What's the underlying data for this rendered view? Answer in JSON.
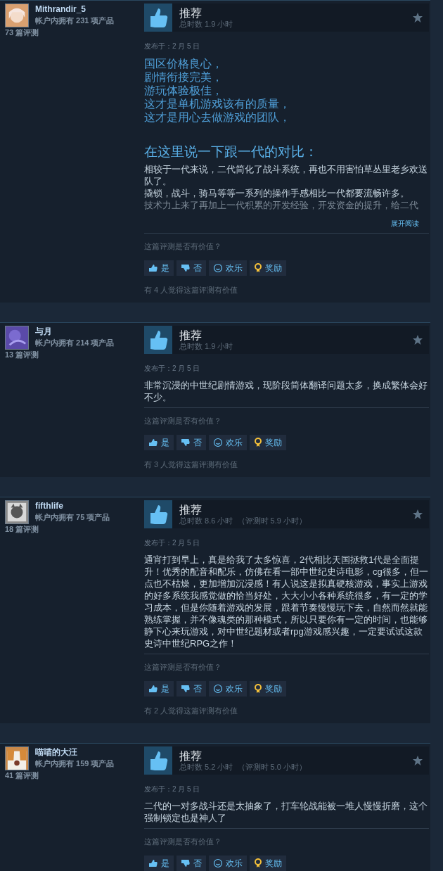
{
  "reviews": [
    {
      "user": {
        "name": "Mithrandir_5",
        "products": "帐户内拥有 231 项产品",
        "review_count": "73 篇评测"
      },
      "verdict": "推荐",
      "hours": "总时数 1.9 小时",
      "date": "发布于：2 月 5 日",
      "body": [
        {
          "kind": "highlight",
          "text": "国区价格良心，"
        },
        {
          "kind": "highlight",
          "text": "剧情衔接完美，"
        },
        {
          "kind": "highlight",
          "text": "游玩体验极佳，"
        },
        {
          "kind": "highlight",
          "text": "这才是单机游戏该有的质量，"
        },
        {
          "kind": "highlight",
          "text": "这才是用心去做游戏的团队，"
        },
        {
          "kind": "heading",
          "text": "在这里说一下跟一代的对比："
        },
        {
          "kind": "plain",
          "text": "相较于一代来说，二代简化了战斗系统，再也不用害怕草丛里老乡欢送队了。"
        },
        {
          "kind": "plain",
          "text": "撬锁，战斗，骑马等等一系列的操作手感相比一代都要流畅许多。"
        },
        {
          "kind": "faded",
          "text": "技术力上来了再加上一代积累的开发经验，开发资金的提升，给二代"
        }
      ],
      "expand": "展开阅读",
      "question": "这篇评测是否有价值？",
      "buttons": [
        {
          "kind": "yes",
          "label": "是"
        },
        {
          "kind": "no",
          "label": "否"
        },
        {
          "kind": "funny",
          "label": "欢乐"
        },
        {
          "kind": "award",
          "label": "奖励"
        }
      ],
      "helpful": "有 4 人觉得这篇评测有价值"
    },
    {
      "user": {
        "name": "与月",
        "products": "帐户内拥有 214 项产品",
        "review_count": "13 篇评测"
      },
      "verdict": "推荐",
      "hours": "总时数 1.9 小时",
      "date": "发布于：2 月 5 日",
      "body": [
        {
          "kind": "plain",
          "text": "非常沉浸的中世纪剧情游戏，现阶段简体翻译问题太多，换成繁体会好不少。"
        }
      ],
      "question": "这篇评测是否有价值？",
      "buttons": [
        {
          "kind": "yes",
          "label": "是"
        },
        {
          "kind": "no",
          "label": "否"
        },
        {
          "kind": "funny",
          "label": "欢乐"
        },
        {
          "kind": "award",
          "label": "奖励"
        }
      ],
      "helpful": "有 3 人觉得这篇评测有价值"
    },
    {
      "user": {
        "name": "fifthlife",
        "products": "帐户内拥有 75 项产品",
        "review_count": "18 篇评测"
      },
      "verdict": "推荐",
      "hours": "总时数 8.6 小时  （评测时 5.9 小时）",
      "date": "发布于：2 月 5 日",
      "body": [
        {
          "kind": "plain",
          "text": "通宵打到早上，真是给我了太多惊喜，2代相比天国拯救1代是全面提升！优秀的配音和配乐，仿佛在看一部中世纪史诗电影，cg很多，但一点也不枯燥，更加增加沉浸感！有人说这是拟真硬核游戏，事实上游戏的好多系统我感觉做的恰当好处，大大小小各种系统很多，有一定的学习成本，但是你随着游戏的发展，跟着节奏慢慢玩下去，自然而然就能熟练掌握，并不像魂类的那种模式，所以只要你有一定的时间，也能够静下心来玩游戏，对中世纪题材或者rpg游戏感兴趣，一定要试试这款史诗中世纪RPG之作！"
        }
      ],
      "question": "这篇评测是否有价值？",
      "buttons": [
        {
          "kind": "yes",
          "label": "是"
        },
        {
          "kind": "no",
          "label": "否"
        },
        {
          "kind": "funny",
          "label": "欢乐"
        },
        {
          "kind": "award",
          "label": "奖励"
        }
      ],
      "helpful": "有 2 人觉得这篇评测有价值"
    },
    {
      "user": {
        "name": "喵喵的大汪",
        "products": "帐户内拥有 159 项产品",
        "review_count": "41 篇评测"
      },
      "verdict": "推荐",
      "hours": "总时数 5.2 小时  （评测时 5.0 小时）",
      "date": "发布于：2 月 5 日",
      "body": [
        {
          "kind": "plain",
          "text": "二代的一对多战斗还是太抽象了，打车轮战能被一堆人慢慢折磨，这个强制锁定也是神人了"
        }
      ],
      "question": "这篇评测是否有价值？",
      "buttons": [
        {
          "kind": "yes",
          "label": "是"
        },
        {
          "kind": "no",
          "label": "否"
        },
        {
          "kind": "funny",
          "label": "欢乐"
        },
        {
          "kind": "award",
          "label": "奖励"
        }
      ]
    }
  ]
}
